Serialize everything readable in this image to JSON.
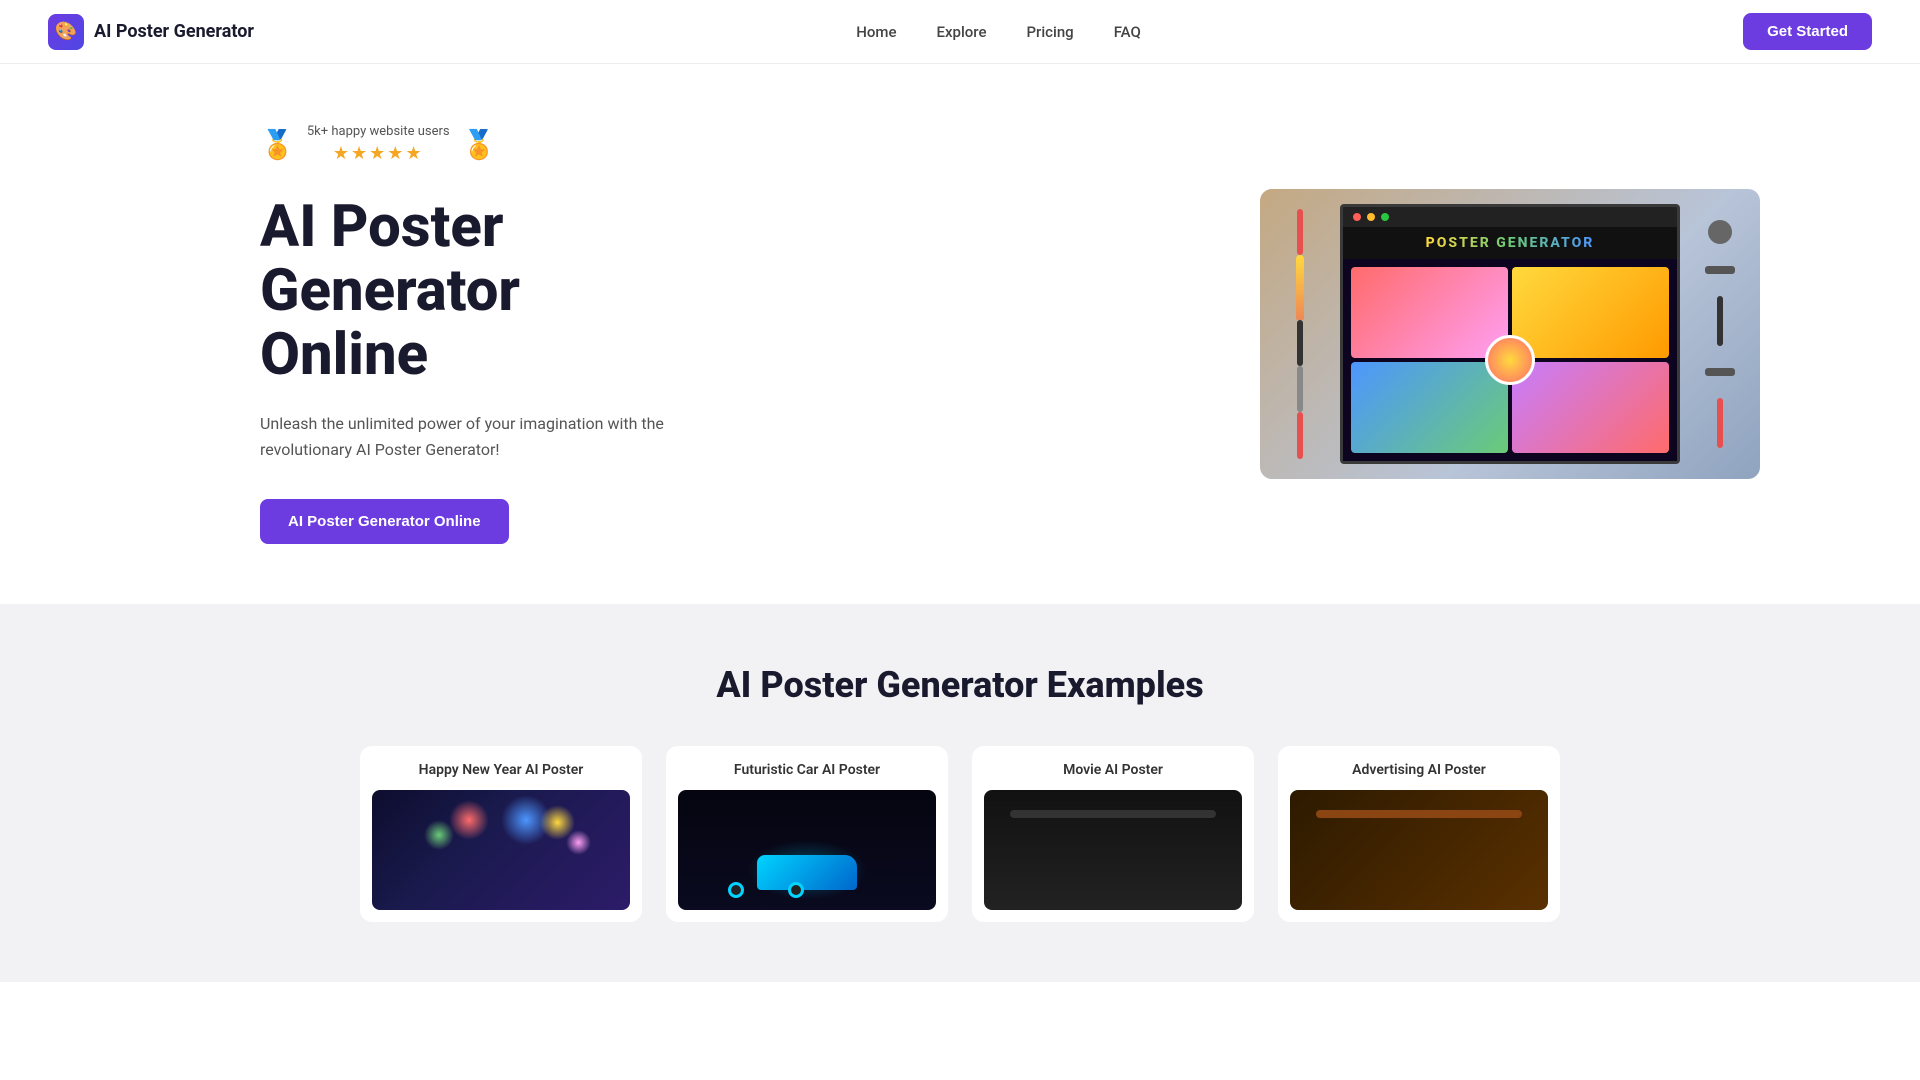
{
  "nav": {
    "logo_icon": "🎨",
    "logo_text": "AI Poster Generator",
    "links": [
      {
        "label": "Home",
        "id": "home"
      },
      {
        "label": "Explore",
        "id": "explore"
      },
      {
        "label": "Pricing",
        "id": "pricing"
      },
      {
        "label": "FAQ",
        "id": "faq"
      }
    ],
    "cta_button": "Get Started"
  },
  "hero": {
    "badge_text": "5k+ happy website users",
    "stars": "★★★★★",
    "title_line1": "AI Poster",
    "title_line2": "Generator",
    "title_line3": "Online",
    "description": "Unleash the unlimited power of your imagination with the revolutionary AI Poster Generator!",
    "cta_label": "AI Poster Generator Online",
    "image_alt": "AI Poster Generator Interface"
  },
  "examples": {
    "section_title": "AI Poster Generator Examples",
    "cards": [
      {
        "id": "new-year",
        "title": "Happy New Year AI Poster"
      },
      {
        "id": "car",
        "title": "Futuristic Car AI Poster"
      },
      {
        "id": "movie",
        "title": "Movie AI Poster"
      },
      {
        "id": "advertising",
        "title": "Advertising AI Poster"
      }
    ]
  }
}
